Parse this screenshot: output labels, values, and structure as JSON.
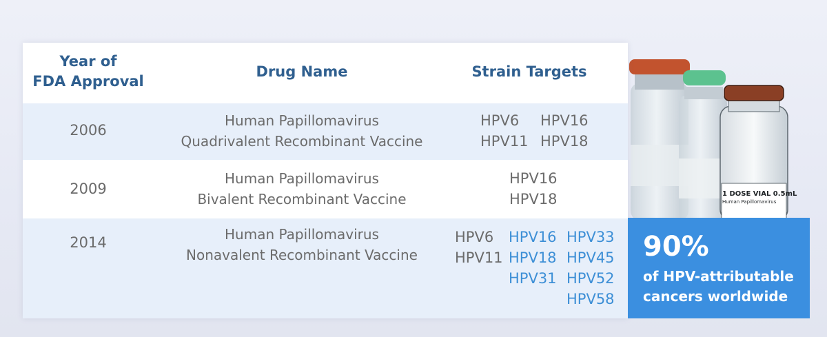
{
  "table": {
    "headers": {
      "year_line1": "Year of",
      "year_line2": "FDA Approval",
      "drug": "Drug Name",
      "strain": "Strain Targets"
    },
    "rows": [
      {
        "year": "2006",
        "drug_line1": "Human Papillomavirus",
        "drug_line2": "Quadrivalent Recombinant Vaccine",
        "strains": [
          "HPV6",
          "HPV16",
          "HPV11",
          "HPV18"
        ]
      },
      {
        "year": "2009",
        "drug_line1": "Human Papillomavirus",
        "drug_line2": "Bivalent Recombinant Vaccine",
        "strains": [
          "HPV16",
          "HPV18"
        ]
      },
      {
        "year": "2014",
        "drug_line1": "Human Papillomavirus",
        "drug_line2": "Nonavalent Recombinant Vaccine",
        "strains": [
          "HPV6",
          "HPV16",
          "HPV33",
          "HPV11",
          "HPV18",
          "HPV45",
          "HPV31",
          "HPV52",
          "HPV58"
        ],
        "highlighted_strains": [
          "HPV16",
          "HPV18",
          "HPV31",
          "HPV33",
          "HPV45",
          "HPV52",
          "HPV58"
        ]
      }
    ]
  },
  "vial_label": {
    "line1": "1 DOSE VIAL 0.5mL",
    "line2": "Human Papillomavirus"
  },
  "stat": {
    "percent": "90%",
    "line1": "of HPV-attributable",
    "line2": "cancers worldwide"
  },
  "colors": {
    "header_text": "#2f5f8f",
    "body_text": "#6b6b6b",
    "highlight_strain": "#3d8fd6",
    "stripe": "#e7effa",
    "stat_box": "#3b8fe0",
    "cap_orange": "#c2532e",
    "cap_green": "#5cc28f",
    "cap_brown": "#8a3f25"
  }
}
